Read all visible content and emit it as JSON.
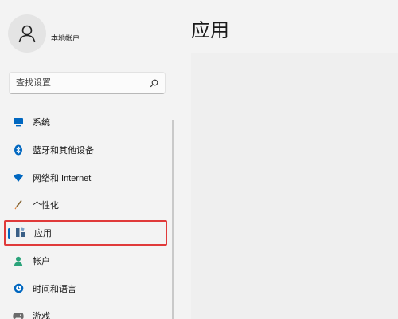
{
  "account": {
    "name": "本地帐户"
  },
  "search": {
    "placeholder": "查找设置"
  },
  "nav": {
    "items": [
      {
        "label": "系统",
        "icon": "system-icon"
      },
      {
        "label": "蓝牙和其他设备",
        "icon": "bluetooth-icon"
      },
      {
        "label": "网络和 Internet",
        "icon": "wifi-icon"
      },
      {
        "label": "个性化",
        "icon": "brush-icon"
      },
      {
        "label": "应用",
        "icon": "apps-icon",
        "selected": true
      },
      {
        "label": "帐户",
        "icon": "person-icon"
      },
      {
        "label": "时间和语言",
        "icon": "globe-clock-icon"
      },
      {
        "label": "游戏",
        "icon": "gamepad-icon"
      }
    ]
  },
  "page": {
    "title": "应用"
  },
  "colors": {
    "accent": "#0067c0",
    "highlight_border": "#e03a3a",
    "background": "#f3f3f3"
  }
}
